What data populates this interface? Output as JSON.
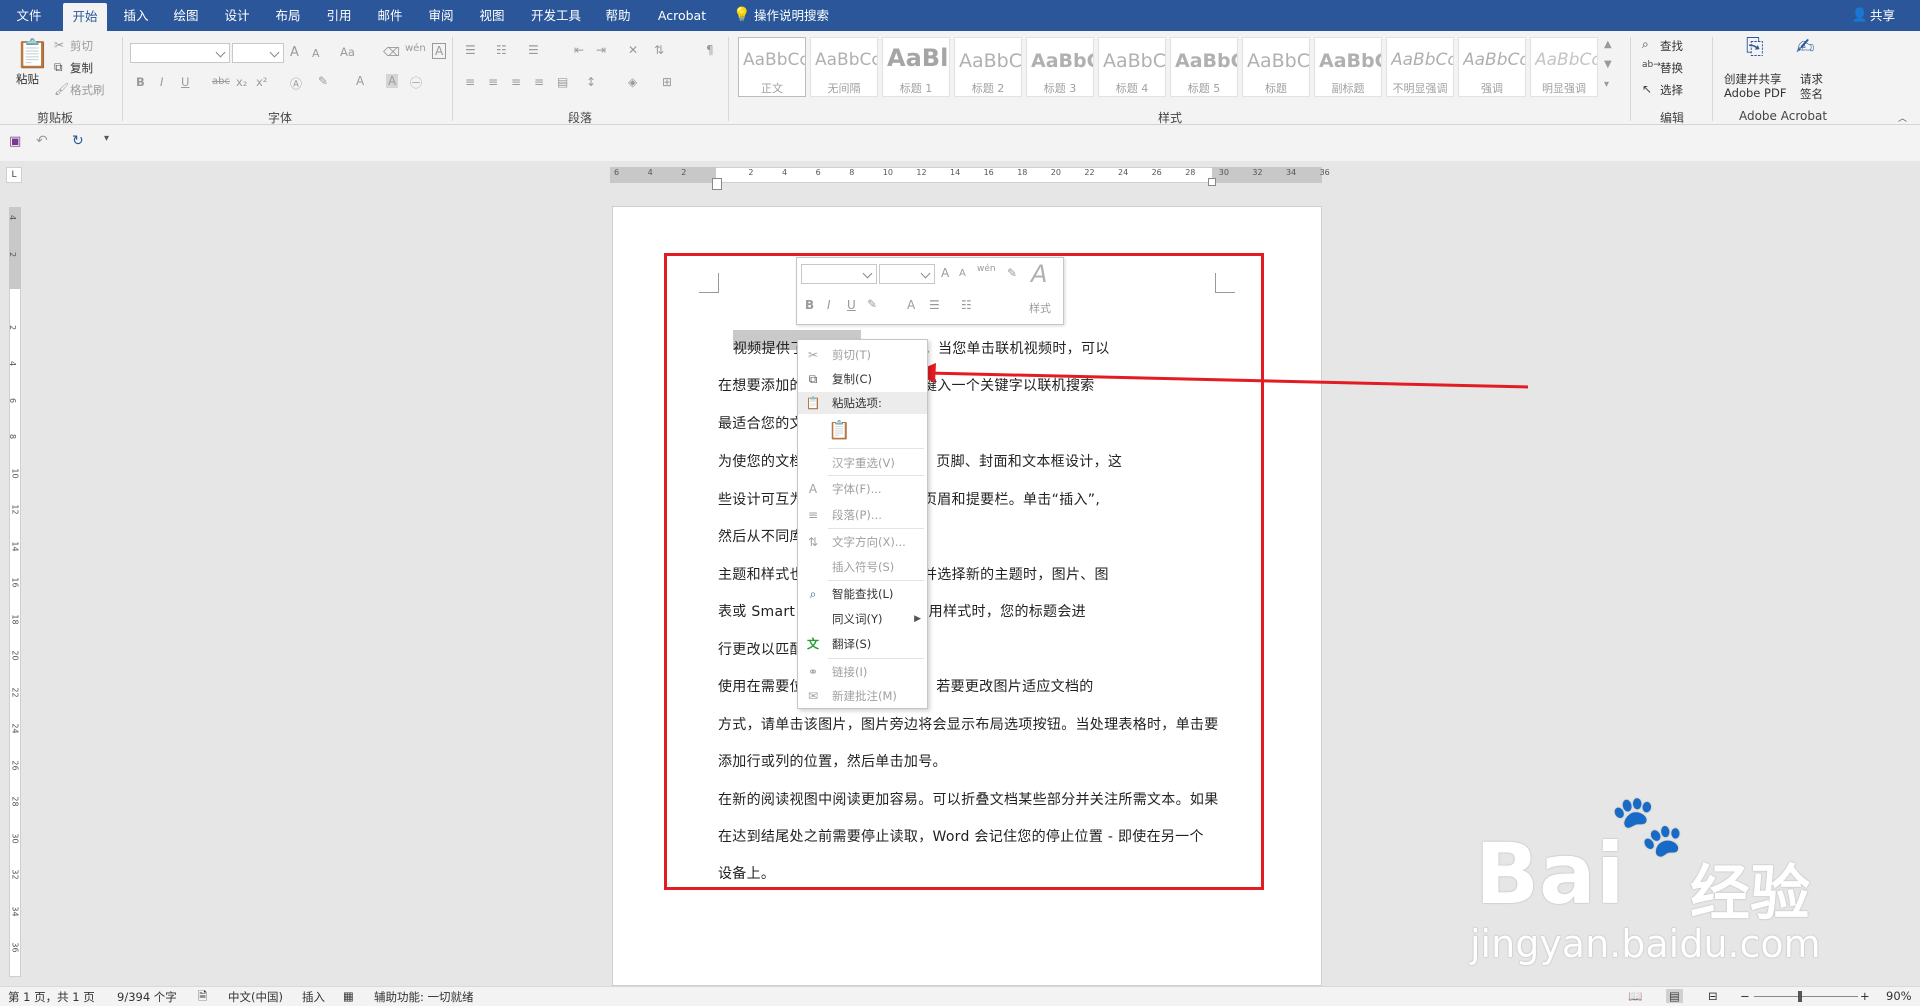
{
  "tabs": [
    "文件",
    "开始",
    "插入",
    "绘图",
    "设计",
    "布局",
    "引用",
    "邮件",
    "审阅",
    "视图",
    "开发工具",
    "帮助",
    "Acrobat"
  ],
  "active_tab": "开始",
  "tell_me": "操作说明搜索",
  "share": "共享",
  "clipboard": {
    "paste": "粘贴",
    "cut": "剪切",
    "copy": "复制",
    "format_painter": "格式刷",
    "label": "剪贴板"
  },
  "font_group": {
    "label": "字体",
    "grow": "A",
    "shrink": "A",
    "case": "Aa",
    "bold": "B",
    "italic": "I",
    "underline": "U",
    "strike": "abc",
    "sub": "x₂",
    "sup": "x²"
  },
  "paragraph_group": {
    "label": "段落"
  },
  "styles": {
    "label": "样式",
    "items": [
      {
        "preview": "AaBbCcI",
        "name": "正文"
      },
      {
        "preview": "AaBbCcI",
        "name": "无间隔"
      },
      {
        "preview": "AaBl",
        "name": "标题 1"
      },
      {
        "preview": "AaBbC",
        "name": "标题 2"
      },
      {
        "preview": "AaBbC",
        "name": "标题 3"
      },
      {
        "preview": "AaBbC",
        "name": "标题 4"
      },
      {
        "preview": "AaBbC",
        "name": "标题 5"
      },
      {
        "preview": "AaBbC",
        "name": "标题"
      },
      {
        "preview": "AaBbC",
        "name": "副标题"
      },
      {
        "preview": "AaBbCc",
        "name": "不明显强调"
      },
      {
        "preview": "AaBbCc",
        "name": "强调"
      },
      {
        "preview": "AaBbCc",
        "name": "明显强调"
      }
    ]
  },
  "editing": {
    "label": "编辑",
    "find": "查找",
    "replace": "替换",
    "select": "选择"
  },
  "acrobat": {
    "label": "Adobe Acrobat",
    "create_l1": "创建并共享",
    "create_l2": "Adobe PDF",
    "sign_l1": "请求",
    "sign_l2": "签名"
  },
  "hruler": [
    "6",
    "4",
    "2",
    "",
    "2",
    "4",
    "6",
    "8",
    "10",
    "12",
    "14",
    "16",
    "18",
    "20",
    "22",
    "24",
    "26",
    "28",
    "30",
    "32",
    "34",
    "36"
  ],
  "vruler": [
    "4",
    "2",
    "",
    "2",
    "4",
    "6",
    "8",
    "10",
    "12",
    "14",
    "16",
    "18",
    "20",
    "22",
    "24",
    "26",
    "28",
    "30",
    "32",
    "34",
    "36"
  ],
  "document": {
    "lines": [
      {
        "indent": true,
        "text": "视频提供了                        助您证明您的观点。当您单击联机视频时，可以"
      },
      {
        "text": "在想要添加的                       行粘贴。您也可以键入一个关键字以联机搜索"
      },
      {
        "text": "最适合您的文"
      },
      {
        "text": "为使您的文档                  Word 提供了页眉、页脚、封面和文本框设计，这"
      },
      {
        "text": "些设计可互为                    添加匹配的封面、页眉和提要栏。单击“插入”,"
      },
      {
        "text": "然后从不同库"
      },
      {
        "text": "主题和样式也                    调。当您单击设计并选择新的主题时，图片、图"
      },
      {
        "text": "表或 Smart                      匹配新的主题。当应用样式时，您的标题会进"
      },
      {
        "text": "行更改以匹配"
      },
      {
        "text": "使用在需要位                    Word 中保存时间。若要更改图片适应文档的"
      },
      {
        "text": "方式，请单击该图片，图片旁边将会显示布局选项按钮。当处理表格时，单击要"
      },
      {
        "text": "添加行或列的位置，然后单击加号。"
      },
      {
        "text": "在新的阅读视图中阅读更加容易。可以折叠文档某些部分并关注所需文本。如果"
      },
      {
        "text": "在达到结尾处之前需要停止读取，Word 会记住您的停止位置 - 即使在另一个"
      },
      {
        "text": "设备上。"
      }
    ]
  },
  "mini_toolbar": {
    "styles_label": "样式"
  },
  "context_menu": {
    "items": [
      {
        "label": "剪切(T)",
        "enabled": false,
        "icon": "✂"
      },
      {
        "label": "复制(C)",
        "enabled": true,
        "icon": "⧉"
      },
      {
        "label": "粘贴选项:",
        "enabled": true,
        "icon": "📋",
        "header": true
      },
      {
        "label": "汉字重选(V)",
        "enabled": false,
        "icon": ""
      },
      {
        "label": "字体(F)...",
        "enabled": false,
        "icon": "A"
      },
      {
        "label": "段落(P)...",
        "enabled": false,
        "icon": "≡"
      },
      {
        "label": "文字方向(X)...",
        "enabled": false,
        "icon": "⇅"
      },
      {
        "label": "插入符号(S)",
        "enabled": false,
        "icon": ""
      },
      {
        "label": "智能查找(L)",
        "enabled": true,
        "icon": "🔍"
      },
      {
        "label": "同义词(Y)",
        "enabled": true,
        "icon": ""
      },
      {
        "label": "翻译(S)",
        "enabled": true,
        "icon": "文"
      },
      {
        "label": "链接(I)",
        "enabled": false,
        "icon": "🔗"
      },
      {
        "label": "新建批注(M)",
        "enabled": false,
        "icon": "💬"
      }
    ]
  },
  "status": {
    "page": "第 1 页，共 1 页",
    "words": "9/394 个字",
    "language": "中文(中国)",
    "mode": "插入",
    "accessibility": "辅助功能: 一切就绪",
    "zoom": "90%"
  },
  "watermark": {
    "brand": "Bai",
    "brand2": "经验",
    "url": "jingyan.baidu.com"
  },
  "colors": {
    "accent": "#2b579a",
    "highlight_box": "#e31b23",
    "arrow": "#e31b23"
  }
}
